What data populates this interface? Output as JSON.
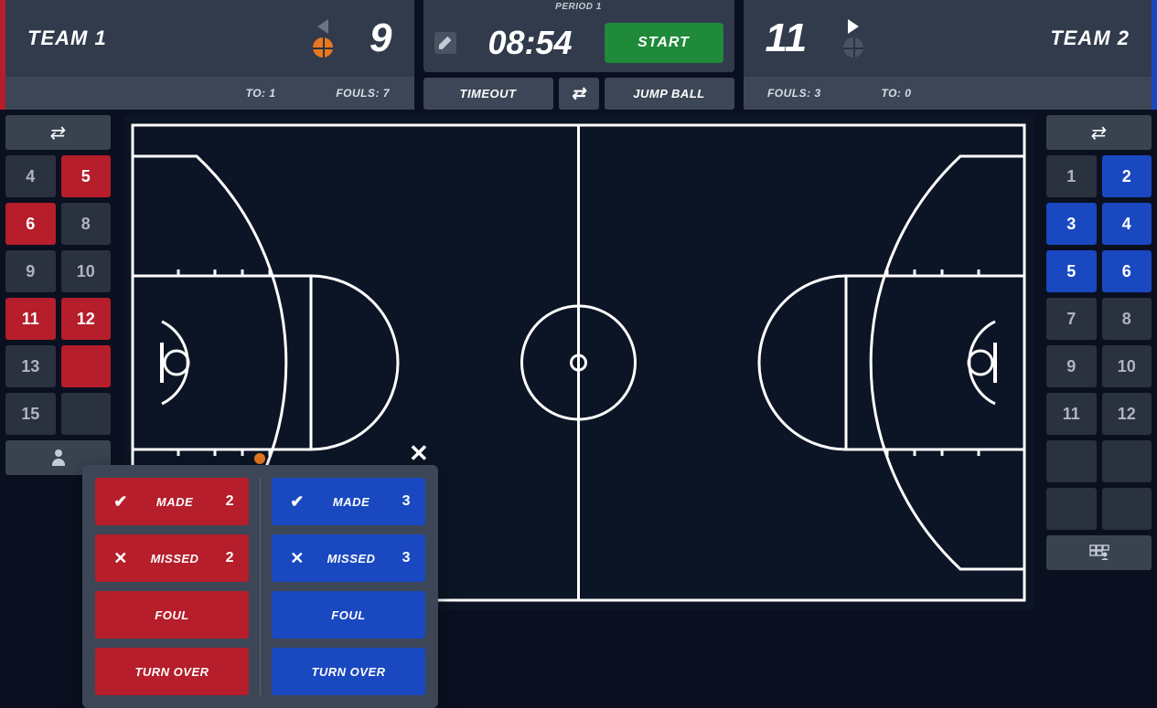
{
  "period_label": "Period 1",
  "clock": "08:54",
  "start_label": "Start",
  "timeout_label": "Timeout",
  "jumpball_label": "Jump Ball",
  "team1": {
    "name": "Team 1",
    "score": "9",
    "to_label": "TO: 1",
    "fouls_label": "Fouls: 7",
    "has_possession": true,
    "arrow_active": false,
    "players": [
      {
        "num": "4",
        "active": false
      },
      {
        "num": "5",
        "active": true
      },
      {
        "num": "6",
        "active": true
      },
      {
        "num": "8",
        "active": false
      },
      {
        "num": "9",
        "active": false
      },
      {
        "num": "10",
        "active": false
      },
      {
        "num": "11",
        "active": true
      },
      {
        "num": "12",
        "active": true
      },
      {
        "num": "13",
        "active": false
      },
      {
        "num": "",
        "active": true
      },
      {
        "num": "15",
        "active": false
      },
      {
        "num": "",
        "active": false
      }
    ]
  },
  "team2": {
    "name": "Team 2",
    "score": "11",
    "to_label": "TO: 0",
    "fouls_label": "Fouls: 3",
    "has_possession": false,
    "arrow_active": true,
    "players": [
      {
        "num": "1",
        "active": false
      },
      {
        "num": "2",
        "active": true
      },
      {
        "num": "3",
        "active": true
      },
      {
        "num": "4",
        "active": true
      },
      {
        "num": "5",
        "active": true
      },
      {
        "num": "6",
        "active": true
      },
      {
        "num": "7",
        "active": false
      },
      {
        "num": "8",
        "active": false
      },
      {
        "num": "9",
        "active": false
      },
      {
        "num": "10",
        "active": false
      },
      {
        "num": "11",
        "active": false
      },
      {
        "num": "12",
        "active": false
      },
      {
        "num": "",
        "active": false
      },
      {
        "num": "",
        "active": false
      },
      {
        "num": "",
        "active": false
      },
      {
        "num": "",
        "active": false
      }
    ]
  },
  "popup": {
    "made": "Made",
    "missed": "Missed",
    "foul": "Foul",
    "turnover": "Turn Over",
    "pts2": "2",
    "pts3": "3"
  }
}
